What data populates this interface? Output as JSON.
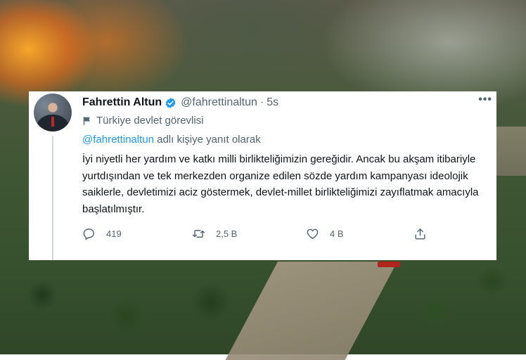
{
  "tweet": {
    "display_name": "Fahrettin Altun",
    "handle": "@fahrettinaltun",
    "separator": "·",
    "time": "5s",
    "account_label": "Türkiye devlet görevlisi",
    "reply_mention": "@fahrettinaltun",
    "reply_suffix": " adlı kişiye yanıt olarak",
    "text": "İyi niyetli her yardım ve katkı milli birlikteliğimizin gereğidir. Ancak bu akşam itibariyle yurtdışından ve tek merkezden organize edilen sözde yardım kampanyası ideolojik saiklerle, devletimizi aciz göstermek, devlet-millet birlikteliğimizi zayıflatmak amacıyla başlatılmıştır.",
    "more_label": "•••",
    "actions": {
      "reply_count": "419",
      "retweet_count": "2,5 B",
      "like_count": "4 B"
    }
  },
  "colors": {
    "accent": "#1d9bf0",
    "secondary_text": "#536471",
    "primary_text": "#0f1419"
  },
  "icons": [
    "verified-badge-icon",
    "flag-icon",
    "reply-icon",
    "retweet-icon",
    "like-icon",
    "share-icon",
    "more-icon"
  ]
}
